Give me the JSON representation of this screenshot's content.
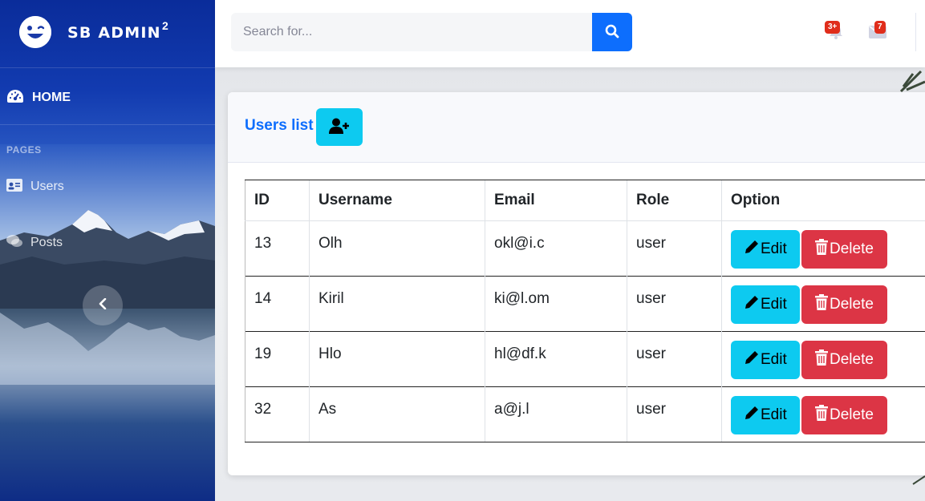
{
  "brand": {
    "name": "SB ADMIN",
    "sup": "2"
  },
  "sidebar": {
    "home_label": "HOME",
    "section_heading": "PAGES",
    "items": [
      {
        "label": "Users",
        "icon": "id-card-icon"
      },
      {
        "label": "Posts",
        "icon": "comments-icon"
      }
    ]
  },
  "topbar": {
    "search_placeholder": "Search for...",
    "alerts_count": "3+",
    "messages_count": "7"
  },
  "card": {
    "title": "Users list"
  },
  "table": {
    "headers": [
      "ID",
      "Username",
      "Email",
      "Role",
      "Option"
    ],
    "rows": [
      {
        "id": "13",
        "username": "Olh",
        "email": "okl@i.c",
        "role": "user"
      },
      {
        "id": "14",
        "username": "Kiril",
        "email": "ki@l.om",
        "role": "user"
      },
      {
        "id": "19",
        "username": "Hlo",
        "email": "hl@df.k",
        "role": "user"
      },
      {
        "id": "32",
        "username": "As",
        "email": "a@j.l",
        "role": "user"
      }
    ],
    "edit_label": "Edit",
    "delete_label": "Delete"
  },
  "colors": {
    "primary": "#0d6efd",
    "info": "#0dcaf0",
    "danger": "#dc3545",
    "badge": "#e02d1b"
  }
}
